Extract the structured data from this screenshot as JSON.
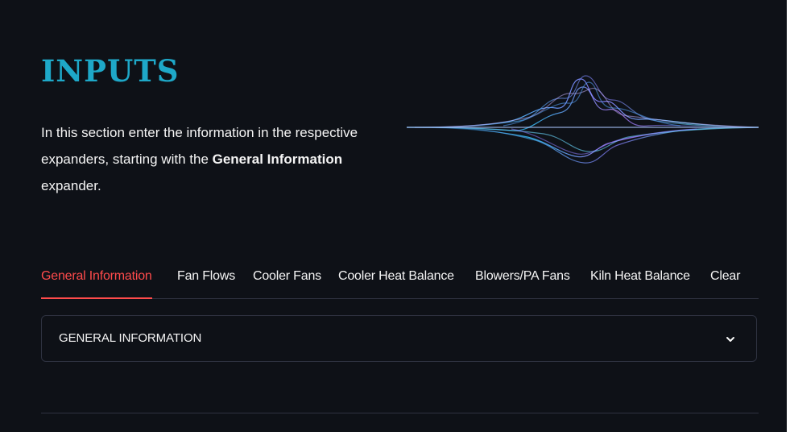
{
  "header": {
    "title": "INPUTS"
  },
  "intro": {
    "text_1": "In this section enter the information in the respective expanders, starting with the ",
    "bold_1": "General Information",
    "text_2": " expander."
  },
  "tabs": [
    {
      "label": "General Information",
      "active": true
    },
    {
      "label": "Fan Flows",
      "active": false
    },
    {
      "label": "Cooler Fans",
      "active": false
    },
    {
      "label": "Cooler Heat Balance",
      "active": false
    },
    {
      "label": "Blowers/PA Fans",
      "active": false
    },
    {
      "label": "Kiln Heat Balance",
      "active": false
    },
    {
      "label": "Clear",
      "active": false
    }
  ],
  "expander": {
    "label": "GENERAL INFORMATION",
    "icon": "chevron-down-icon"
  },
  "colors": {
    "background": "#0e1117",
    "title": "#1ea8c8",
    "accent": "#ff4b4b",
    "text": "#fafafa",
    "border": "#2e3240"
  }
}
